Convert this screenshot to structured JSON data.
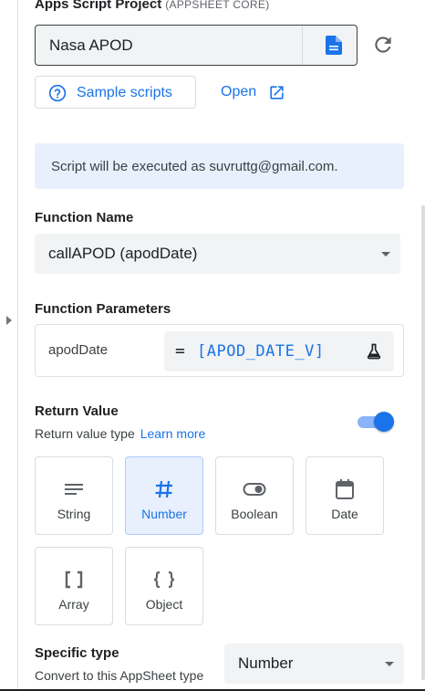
{
  "project": {
    "label": "Apps Script Project",
    "label_sub": "(APPSHEET CORE)",
    "value": "Nasa APOD",
    "doc_icon": "google-doc-icon",
    "refresh_icon": "refresh-icon"
  },
  "actions": {
    "sample_label": "Sample scripts",
    "sample_icon": "help-circle-icon",
    "open_label": "Open",
    "open_icon": "open-in-new-icon"
  },
  "info": {
    "text": "Script will be executed as suvruttg@gmail.com."
  },
  "function_name": {
    "label": "Function Name",
    "value": "callAPOD (apodDate)"
  },
  "function_params": {
    "label": "Function Parameters",
    "params": [
      {
        "name": "apodDate",
        "equals": "=",
        "expression": "[APOD_DATE_V]"
      }
    ],
    "test_icon": "flask-icon"
  },
  "return_value": {
    "label": "Return Value",
    "sub_label": "Return value type",
    "learn_more": "Learn more",
    "enabled": true,
    "types": [
      {
        "label": "String",
        "icon": "text-lines-icon",
        "selected": false
      },
      {
        "label": "Number",
        "icon": "hash-icon",
        "selected": true
      },
      {
        "label": "Boolean",
        "icon": "toggle-icon",
        "selected": false
      },
      {
        "label": "Date",
        "icon": "calendar-icon",
        "selected": false
      },
      {
        "label": "Array",
        "icon": "brackets-icon",
        "selected": false
      },
      {
        "label": "Object",
        "icon": "braces-icon",
        "selected": false
      }
    ]
  },
  "specific_type": {
    "label": "Specific type",
    "sub_label": "Convert to this AppSheet type",
    "value": "Number"
  },
  "colors": {
    "accent": "#1a73e8",
    "info_bg": "#e8f0fe",
    "field_bg": "#f1f3f4"
  }
}
